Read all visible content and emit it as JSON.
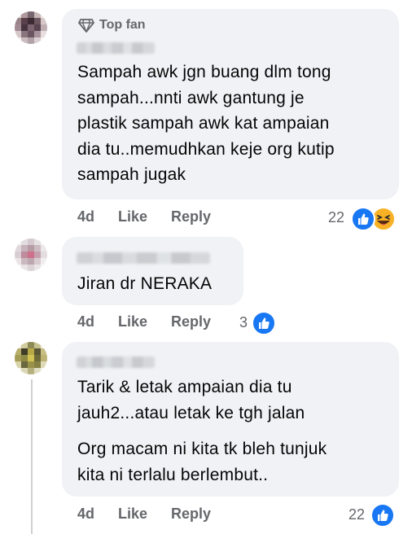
{
  "comments": [
    {
      "badge": "Top fan",
      "text": "Sampah awk jgn buang dlm tong\nsampah...nnti awk gantung je\nplastik sampah awk kat ampaian\ndia tu..memudhkan keje org kutip\nsampah jugak",
      "time": "4d",
      "like_label": "Like",
      "reply_label": "Reply",
      "reaction_count": "22",
      "reactions": [
        "like-icon",
        "haha-icon"
      ]
    },
    {
      "text": "Jiran dr NERAKA",
      "time": "4d",
      "like_label": "Like",
      "reply_label": "Reply",
      "reaction_count": "3",
      "reactions": [
        "like-icon"
      ]
    },
    {
      "text": "Tarik & letak ampaian dia tu\njauh2...atau letak ke tgh jalan",
      "text2": "Org macam ni kita tk bleh tunjuk\nkita ni terlalu berlembut..",
      "time": "4d",
      "like_label": "Like",
      "reply_label": "Reply",
      "reaction_count": "22",
      "reactions": [
        "like-icon"
      ]
    }
  ],
  "colors": {
    "bubble": "#f0f2f5",
    "meta": "#65676b",
    "like": "#1877f2",
    "haha": "#f7b125"
  }
}
